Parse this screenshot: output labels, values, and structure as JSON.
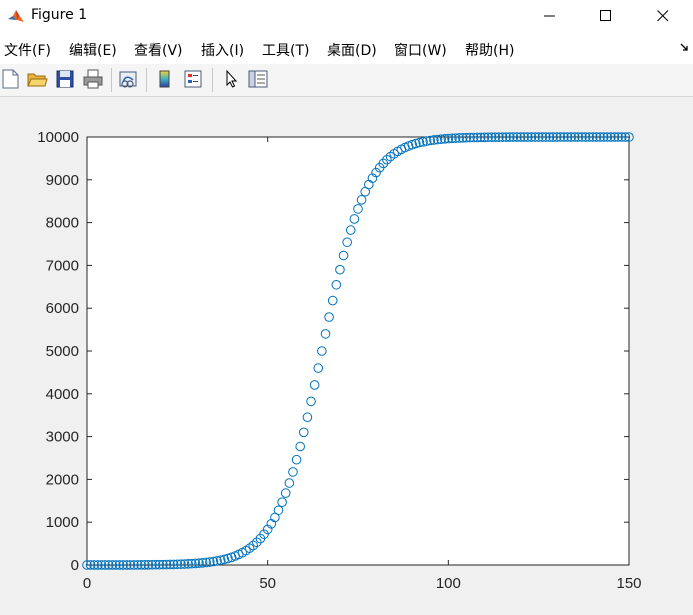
{
  "window": {
    "title": "Figure 1",
    "icon": "matlab-logo-icon",
    "controls": [
      "minimize-icon",
      "maximize-icon",
      "close-icon"
    ]
  },
  "menu": {
    "items": [
      "文件(F)",
      "编辑(E)",
      "查看(V)",
      "插入(I)",
      "工具(T)",
      "桌面(D)",
      "窗口(W)",
      "帮助(H)"
    ],
    "overflow_icon": "dock-arrow-icon"
  },
  "toolbar": {
    "icons": [
      "new-figure-icon",
      "open-file-icon",
      "save-icon",
      "print-icon",
      "link-plot-icon",
      "insert-colorbar-icon",
      "insert-legend-icon",
      "edit-plot-arrow-icon",
      "property-inspector-icon"
    ]
  },
  "colors": {
    "marker": "#0072BD",
    "axes": "#262626",
    "figure_bg": "#f0f0f0",
    "axes_bg": "#ffffff"
  },
  "chart_data": {
    "type": "scatter",
    "marker": "circle-open",
    "title": "",
    "xlabel": "",
    "ylabel": "",
    "xlim": [
      0,
      150
    ],
    "ylim": [
      0,
      10000
    ],
    "xticks": [
      0,
      50,
      100,
      150
    ],
    "yticks": [
      0,
      1000,
      2000,
      3000,
      4000,
      5000,
      6000,
      7000,
      8000,
      9000,
      10000
    ],
    "grid": false,
    "series": [
      {
        "model": "logistic",
        "x_start": 0,
        "x_end": 150,
        "x_step": 1,
        "capacity": 10000,
        "midpoint_x": 65,
        "growth_rate": 0.16,
        "sample_points": [
          [
            20,
            7
          ],
          [
            40,
            418
          ],
          [
            50,
            1162
          ],
          [
            60,
            3100
          ],
          [
            65,
            5000
          ],
          [
            70,
            6900
          ],
          [
            80,
            9162
          ],
          [
            90,
            9820
          ],
          [
            100,
            9960
          ],
          [
            150,
            10000
          ]
        ]
      }
    ]
  }
}
